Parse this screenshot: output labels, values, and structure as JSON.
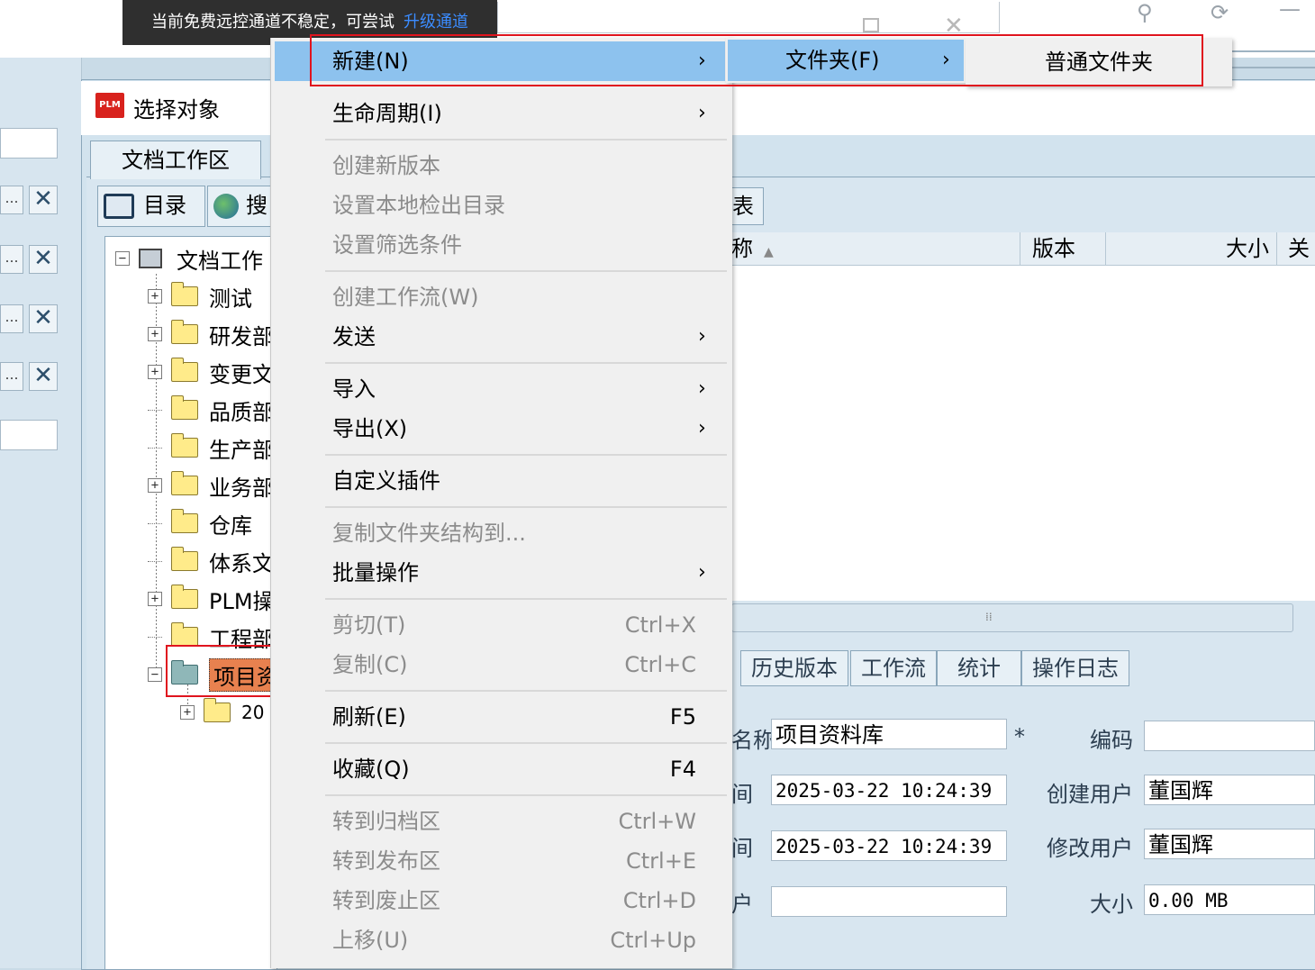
{
  "remote_banner": {
    "text": "当前免费远控通道不稳定，可尝试",
    "link": "升级通道"
  },
  "dialog": {
    "logo": "PLM",
    "title": "选择对象"
  },
  "workspace_tab": "文档工作区",
  "sub_tabs": {
    "directory": "目录",
    "search": "搜"
  },
  "tree": {
    "root": "文档工作",
    "items": [
      {
        "label": "测试",
        "expandable": true
      },
      {
        "label": "研发部",
        "expandable": true
      },
      {
        "label": "变更文",
        "expandable": true
      },
      {
        "label": "品质部",
        "expandable": false
      },
      {
        "label": "生产部",
        "expandable": false
      },
      {
        "label": "业务部",
        "expandable": true
      },
      {
        "label": "仓库",
        "expandable": false
      },
      {
        "label": "体系文",
        "expandable": false
      },
      {
        "label": "PLM操",
        "expandable": true
      },
      {
        "label": "工程部",
        "expandable": false
      }
    ],
    "selected": "项目资",
    "child": "20"
  },
  "context_menu": {
    "new": "新建(N)",
    "lifecycle": "生命周期(I)",
    "create_version": "创建新版本",
    "set_checkout_dir": "设置本地检出目录",
    "set_filter": "设置筛选条件",
    "create_workflow": "创建工作流(W)",
    "send": "发送",
    "import": "导入",
    "export": "导出(X)",
    "custom_plugin": "自定义插件",
    "copy_structure": "复制文件夹结构到...",
    "batch": "批量操作",
    "cut": "剪切(T)",
    "cut_sc": "Ctrl+X",
    "copy": "复制(C)",
    "copy_sc": "Ctrl+C",
    "refresh": "刷新(E)",
    "refresh_sc": "F5",
    "favorite": "收藏(Q)",
    "favorite_sc": "F4",
    "to_archive": "转到归档区",
    "to_archive_sc": "Ctrl+W",
    "to_publish": "转到发布区",
    "to_publish_sc": "Ctrl+E",
    "to_obsolete": "转到废止区",
    "to_obsolete_sc": "Ctrl+D",
    "move_up": "上移(U)",
    "move_up_sc": "Ctrl+Up"
  },
  "submenu": {
    "folder": "文件夹(F)"
  },
  "submenu2": {
    "normal_folder": "普通文件夹"
  },
  "list": {
    "tab": "表",
    "columns": {
      "name": "称",
      "version": "版本",
      "size": "大小",
      "related": "关"
    }
  },
  "detail_tabs": [
    "历史版本",
    "工作流",
    "统计",
    "操作日志"
  ],
  "details": {
    "name_label": "名称",
    "name_value": "项目资料库",
    "required_mark": "*",
    "code_label": "编码",
    "code_value": "",
    "create_time_label": "间",
    "create_time_value": "2025-03-22 10:24:39",
    "create_user_label": "创建用户",
    "create_user_value": "董国辉",
    "modify_time_label": "间",
    "modify_time_value": "2025-03-22 10:24:39",
    "modify_user_label": "修改用户",
    "modify_user_value": "董国辉",
    "user_label": "户",
    "user_value": "",
    "size_label": "大小",
    "size_value": "0.00 MB"
  },
  "colors": {
    "menu_hover": "#8dc2ee",
    "highlight_box": "#e0141e",
    "selected_node": "#e8814f"
  }
}
